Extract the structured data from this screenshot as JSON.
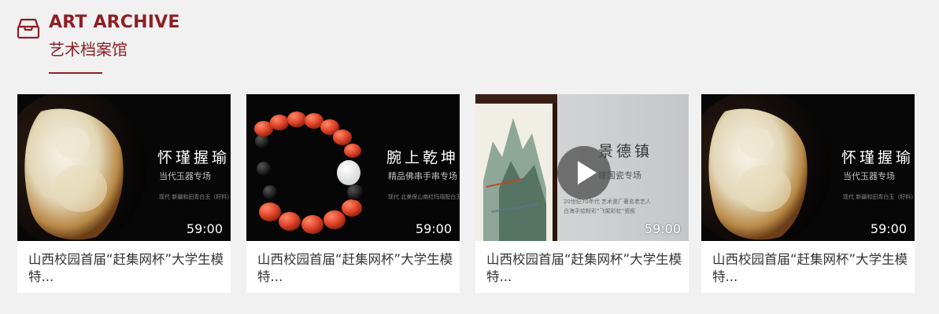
{
  "section": {
    "title_en": "ART ARCHIVE",
    "title_cn": "艺术档案馆",
    "icon": "archive-box-icon"
  },
  "colors": {
    "accent": "#8e1f26",
    "background": "#f1f1f1"
  },
  "videos": [
    {
      "thumb_title": "怀瑾握瑜",
      "thumb_subtitle": "当代玉器专场",
      "thumb_note": "现代 新疆和田青白玉（籽料）随形",
      "duration": "59:00",
      "title": "山西校园首届“赶集网杯”大学生模特..."
    },
    {
      "thumb_title": "腕上乾坤",
      "thumb_subtitle": "精品佛串手串专场",
      "thumb_note": "现代 北美保山南红玛瑙配白玉菩萨",
      "duration": "59:00",
      "title": "山西校园首届“赶集网杯”大学生模特..."
    },
    {
      "thumb_title": "景德镇",
      "thumb_subtitle": "建国瓷专场",
      "thumb_note": "20世纪70年代 艺术瓷厂著名老艺人",
      "thumb_note2": "白海手绘粉彩“飞架彩虹”瓷板",
      "duration": "59:00",
      "title": "山西校园首届“赶集网杯”大学生模特...",
      "play_icon": "play-icon"
    },
    {
      "thumb_title": "怀瑾握瑜",
      "thumb_subtitle": "当代玉器专场",
      "thumb_note": "现代 新疆和田青白玉（籽料）随形",
      "duration": "59:00",
      "title": "山西校园首届“赶集网杯”大学生模特..."
    }
  ]
}
